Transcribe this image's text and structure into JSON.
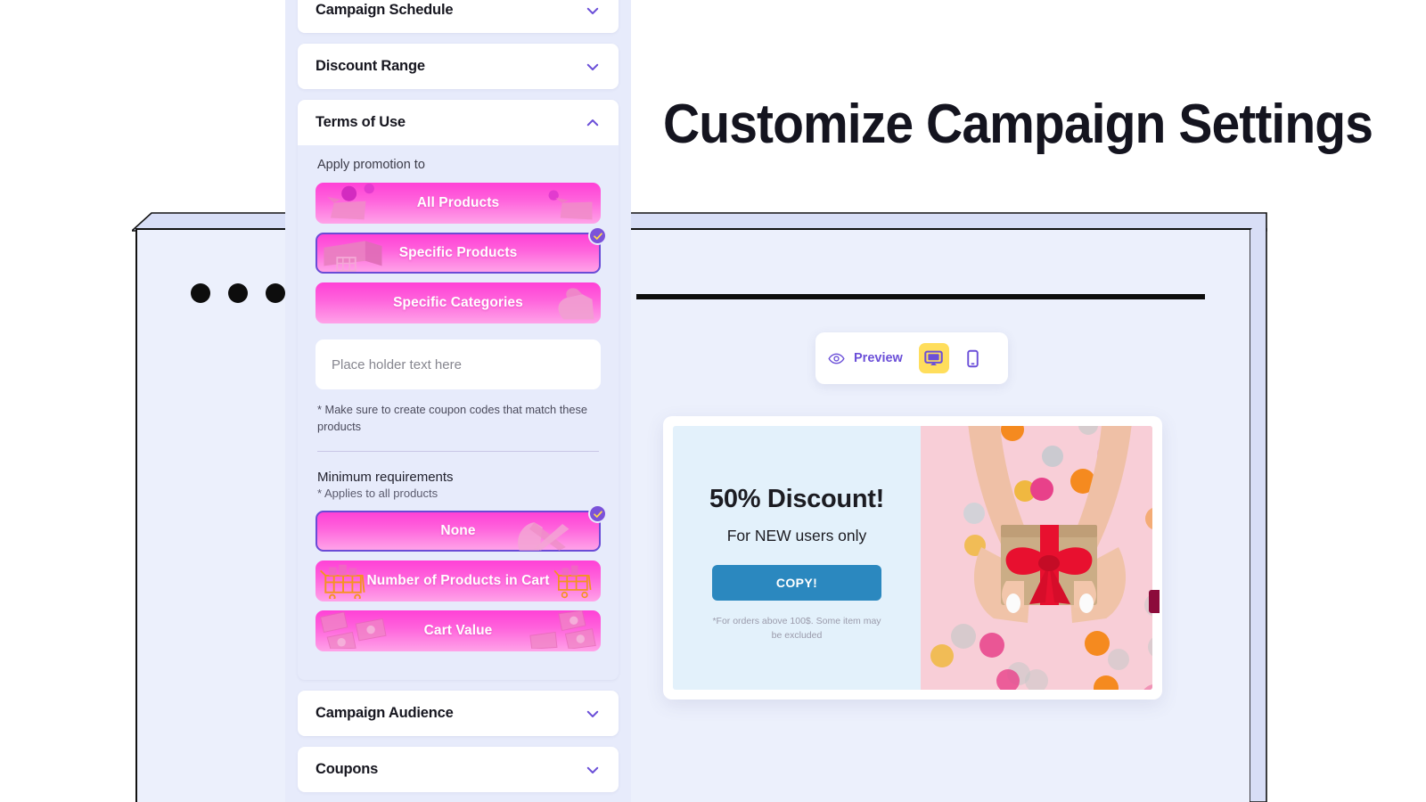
{
  "page": {
    "title": "Customize Campaign Settings",
    "window_dots": 3
  },
  "settings_panel": {
    "accordions": [
      {
        "label": "Campaign Schedule",
        "icon": "chevron-down-icon",
        "expanded": false
      },
      {
        "label": "Discount Range",
        "icon": "chevron-down-icon",
        "expanded": false
      },
      {
        "label": "Terms of Use",
        "icon": "chevron-up-icon",
        "expanded": true
      },
      {
        "label": "Campaign Audience",
        "icon": "chevron-down-icon",
        "expanded": false
      },
      {
        "label": "Coupons",
        "icon": "chevron-down-icon",
        "expanded": false
      }
    ],
    "terms_of_use": {
      "apply_label": "Apply promotion to",
      "apply_options": [
        {
          "label": "All Products",
          "selected": false
        },
        {
          "label": "Specific Products",
          "selected": true
        },
        {
          "label": "Specific Categories",
          "selected": false
        }
      ],
      "products_input": {
        "value": "",
        "placeholder": "Place holder text here"
      },
      "note": "* Make sure to create coupon codes that match these products",
      "minimum_label": "Minimum requirements",
      "minimum_sub": "* Applies to all products",
      "minimum_options": [
        {
          "label": "None",
          "selected": true
        },
        {
          "label": "Number of Products in Cart",
          "selected": false
        },
        {
          "label": "Cart Value",
          "selected": false
        }
      ]
    }
  },
  "preview_bar": {
    "eye_icon": "eye-icon",
    "label": "Preview",
    "devices": [
      {
        "name": "desktop",
        "icon": "desktop-icon",
        "active": true
      },
      {
        "name": "mobile",
        "icon": "mobile-icon",
        "active": false
      }
    ]
  },
  "coupon_preview": {
    "heading": "50% Discount!",
    "subheading": "For NEW users only",
    "button_label": "COPY!",
    "fine_print": "*For orders above 100$. Some item may be excluded",
    "image_alt": "hands-holding-gift-box"
  },
  "colors": {
    "accent_purple": "#6B4FD8",
    "pink_gradient_top": "#FF41D6",
    "pink_gradient_bottom": "#FFA3E8",
    "selected_border": "#6A4BD6",
    "badge_bg": "#7B52D9",
    "badge_check": "#FFD84D",
    "highlight_yellow": "#FFDE5C",
    "panel_bg": "#E7EBFB",
    "frame_bg": "#ECF0FC",
    "coupon_left_bg": "#E3F1FB",
    "copy_button": "#2B88BF",
    "title_color": "#14141F"
  }
}
